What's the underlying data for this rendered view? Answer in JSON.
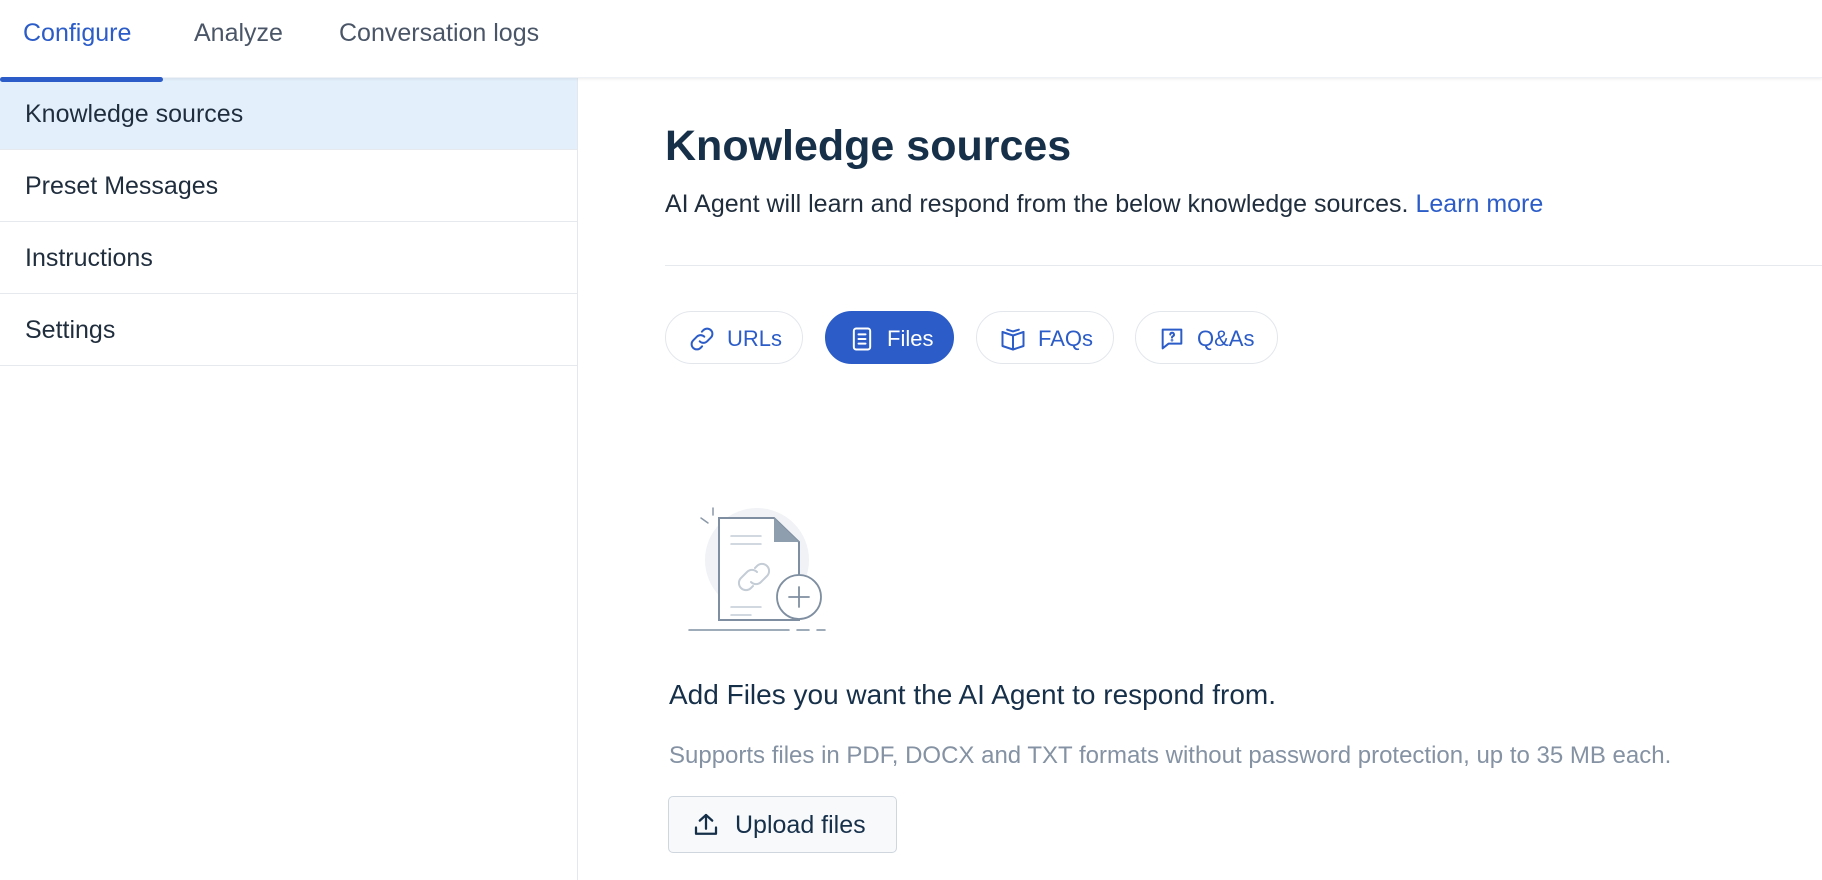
{
  "colors": {
    "accent": "#2b5cc8",
    "active_sidebar_bg": "#e3f0fc",
    "heading": "#17304a",
    "muted_text": "#8492a3"
  },
  "top_tabs": [
    {
      "label": "Configure",
      "active": true
    },
    {
      "label": "Analyze",
      "active": false
    },
    {
      "label": "Conversation logs",
      "active": false
    }
  ],
  "sidebar": {
    "items": [
      {
        "label": "Knowledge sources",
        "active": true
      },
      {
        "label": "Preset Messages",
        "active": false
      },
      {
        "label": "Instructions",
        "active": false
      },
      {
        "label": "Settings",
        "active": false
      }
    ]
  },
  "main": {
    "title": "Knowledge sources",
    "subtitle": "AI Agent will learn and respond from the below knowledge sources.",
    "learn_more": "Learn more",
    "source_tabs": [
      {
        "label": "URLs",
        "icon": "link-icon",
        "active": false
      },
      {
        "label": "Files",
        "icon": "document-icon",
        "active": true
      },
      {
        "label": "FAQs",
        "icon": "book-icon",
        "active": false
      },
      {
        "label": "Q&As",
        "icon": "question-chat-icon",
        "active": false
      }
    ],
    "empty_state": {
      "illustration": "file-upload-illustration",
      "headline": "Add Files you want the AI Agent to respond from.",
      "note": "Supports files in PDF, DOCX and TXT formats without password protection, up to 35 MB each.",
      "upload_label": "Upload files",
      "upload_icon": "upload-icon"
    }
  }
}
